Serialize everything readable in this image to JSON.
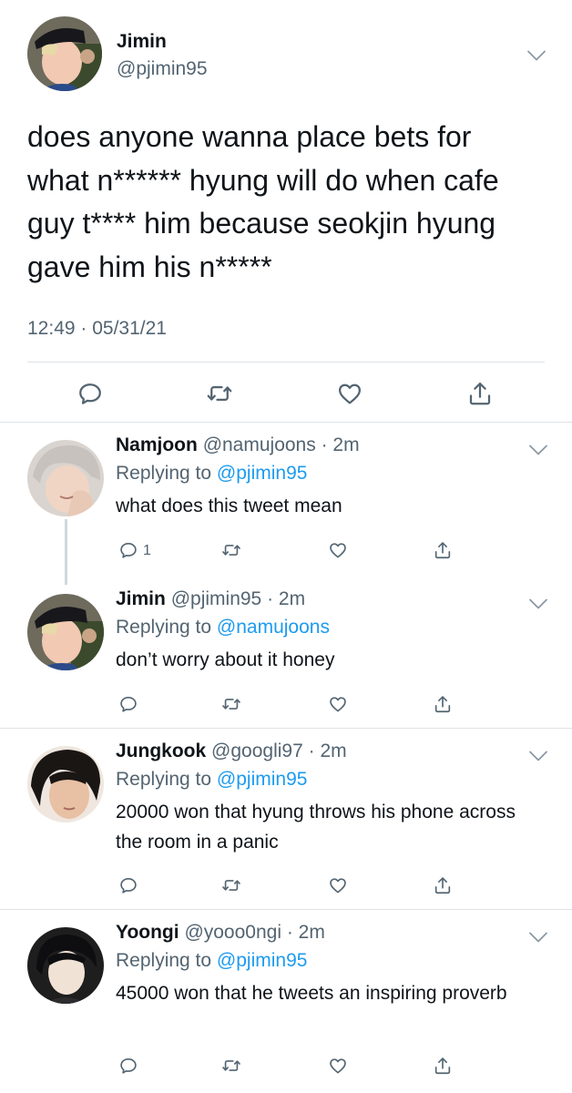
{
  "main_tweet": {
    "name": "Jimin",
    "handle": "@pjimin95",
    "text_lines": [
      "does anyone wanna place bets for",
      "what n****** hyung will do when cafe",
      "guy t**** him because seokjin hyung",
      "gave him his n*****"
    ],
    "timestamp": "12:49 · 05/31/21",
    "icons": [
      "reply-icon",
      "retweet-icon",
      "like-icon",
      "share-icon"
    ]
  },
  "replies": [
    {
      "name": "Namjoon",
      "handle": "@namujoons",
      "time": "2m",
      "replying_label": "Replying to",
      "replying_to": "@pjimin95",
      "text": "what does this tweet mean",
      "reply_count": "1"
    },
    {
      "name": "Jimin",
      "handle": "@pjimin95",
      "time": "2m",
      "replying_label": "Replying to",
      "replying_to": "@namujoons",
      "text": "don’t worry about it honey",
      "reply_count": ""
    },
    {
      "name": "Jungkook",
      "handle": "@googli97",
      "time": "2m",
      "replying_label": "Replying to",
      "replying_to": "@pjimin95",
      "text": "20000 won that hyung throws his phone across the room in a panic",
      "reply_count": ""
    },
    {
      "name": "Yoongi",
      "handle": "@yooo0ngi",
      "time": "2m",
      "replying_label": "Replying to",
      "replying_to": "@pjimin95",
      "text": "45000 won that he tweets an inspiring proverb",
      "reply_count": ""
    }
  ],
  "separator": " · ",
  "colors": {
    "text": "#0f1419",
    "secondary": "#536471",
    "link": "#1d9bf0",
    "divider": "#dfe3e6",
    "thread_line": "#cfd9de"
  }
}
